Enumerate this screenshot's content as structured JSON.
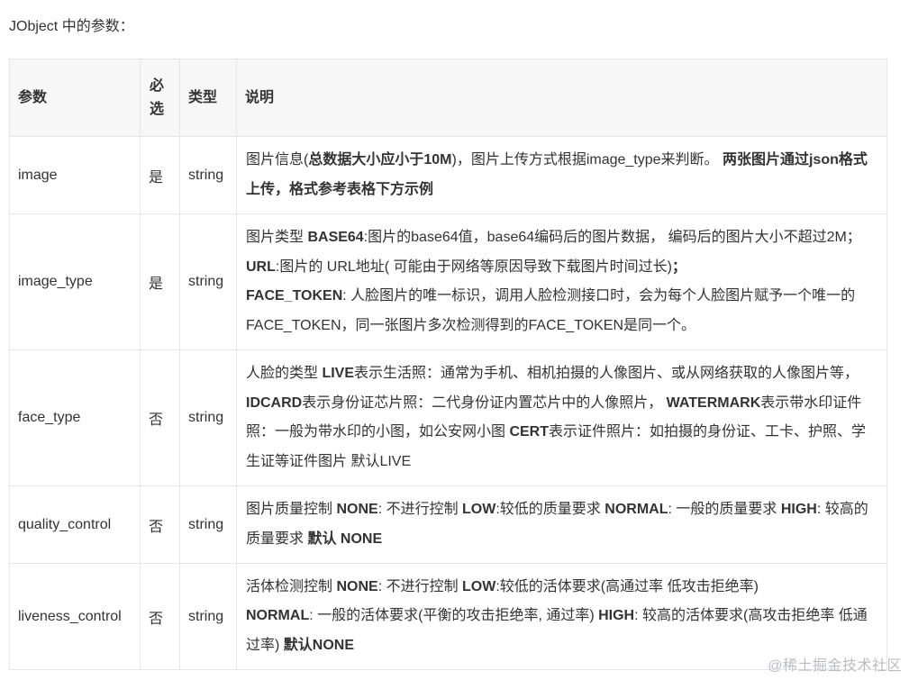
{
  "intro": "JObject 中的参数：",
  "table": {
    "headers": {
      "name": "参数",
      "required": "必选",
      "type": "类型",
      "description": "说明"
    },
    "rows": [
      {
        "name": "image",
        "required": "是",
        "type": "string",
        "description": [
          {
            "text": "图片信息(",
            "bold": false
          },
          {
            "text": "总数据大小应小于10M",
            "bold": true
          },
          {
            "text": ")，图片上传方式根据image_type来判断。 ",
            "bold": false
          },
          {
            "text": "两张图片通过json格式上传，格式参考表格下方示例",
            "bold": true
          }
        ]
      },
      {
        "name": "image_type",
        "required": "是",
        "type": "string",
        "description": [
          {
            "text": "图片类型 ",
            "bold": false
          },
          {
            "text": "BASE64",
            "bold": true
          },
          {
            "text": ":图片的base64值，base64编码后的图片数据， 编码后的图片大小不超过2M；",
            "bold": false
          },
          {
            "text": "URL",
            "bold": true
          },
          {
            "text": ":图片的 URL地址( 可能由于网络等原因导致下载图片时间过长)",
            "bold": false
          },
          {
            "text": "；",
            "bold": true
          },
          {
            "text": "\nFACE_TOKEN",
            "bold": true
          },
          {
            "text": ": 人脸图片的唯一标识，调用人脸检测接口时，会为每个人脸图片赋予一个唯一的FACE_TOKEN，同一张图片多次检测得到的FACE_TOKEN是同一个。",
            "bold": false
          }
        ]
      },
      {
        "name": "face_type",
        "required": "否",
        "type": "string",
        "description": [
          {
            "text": "人脸的类型 ",
            "bold": false
          },
          {
            "text": "LIVE",
            "bold": true
          },
          {
            "text": "表示生活照：通常为手机、相机拍摄的人像图片、或从网络获取的人像图片等，",
            "bold": false
          },
          {
            "text": "IDCARD",
            "bold": true
          },
          {
            "text": "表示身份证芯片照：二代身份证内置芯片中的人像照片， ",
            "bold": false
          },
          {
            "text": "WATERMARK",
            "bold": true
          },
          {
            "text": "表示带水印证件照：一般为带水印的小图，如公安网小图 ",
            "bold": false
          },
          {
            "text": "CERT",
            "bold": true
          },
          {
            "text": "表示证件照片：如拍摄的身份证、工卡、护照、学生证等证件图片 默认LIVE",
            "bold": false
          }
        ]
      },
      {
        "name": "quality_control",
        "required": "否",
        "type": "string",
        "description": [
          {
            "text": "图片质量控制 ",
            "bold": false
          },
          {
            "text": "NONE",
            "bold": true
          },
          {
            "text": ": 不进行控制 ",
            "bold": false
          },
          {
            "text": "LOW",
            "bold": true
          },
          {
            "text": ":较低的质量要求 ",
            "bold": false
          },
          {
            "text": "NORMAL",
            "bold": true
          },
          {
            "text": ": 一般的质量要求 ",
            "bold": false
          },
          {
            "text": "HIGH",
            "bold": true
          },
          {
            "text": ": 较高的质量要求 ",
            "bold": false
          },
          {
            "text": "默认 NONE",
            "bold": true
          }
        ]
      },
      {
        "name": "liveness_control",
        "required": "否",
        "type": "string",
        "description": [
          {
            "text": "活体检测控制 ",
            "bold": false
          },
          {
            "text": "NONE",
            "bold": true
          },
          {
            "text": ": 不进行控制 ",
            "bold": false
          },
          {
            "text": "LOW",
            "bold": true
          },
          {
            "text": ":较低的活体要求(高通过率 低攻击拒绝率)",
            "bold": false
          },
          {
            "text": "\nNORMAL",
            "bold": true
          },
          {
            "text": ": 一般的活体要求(平衡的攻击拒绝率, 通过率) ",
            "bold": false
          },
          {
            "text": "HIGH",
            "bold": true
          },
          {
            "text": ": 较高的活体要求(高攻击拒绝率 低通过率) ",
            "bold": false
          },
          {
            "text": "默认NONE",
            "bold": true
          }
        ]
      }
    ]
  },
  "watermark": "@稀土掘金技术社区"
}
